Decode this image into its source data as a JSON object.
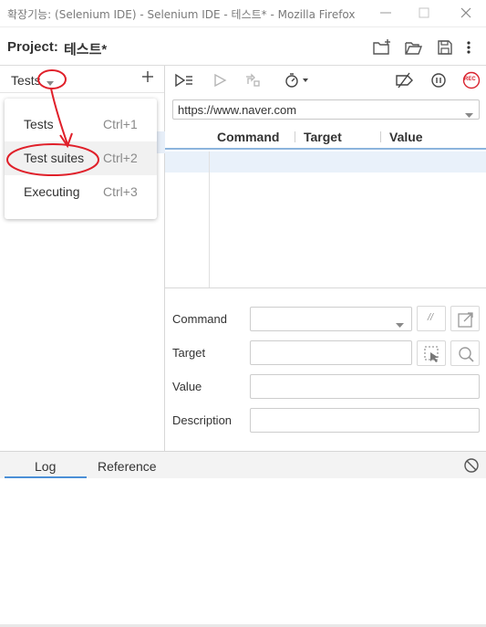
{
  "window": {
    "title": "확장기능: (Selenium IDE) - Selenium IDE - 테스트* - Mozilla Firefox"
  },
  "project": {
    "label": "Project:",
    "name": "테스트*"
  },
  "tests_panel": {
    "label": "Tests",
    "add_icon": "plus-icon",
    "menu": [
      {
        "label": "Tests",
        "shortcut": "Ctrl+1",
        "highlighted": false
      },
      {
        "label": "Test suites",
        "shortcut": "Ctrl+2",
        "highlighted": true
      },
      {
        "label": "Executing",
        "shortcut": "Ctrl+3",
        "highlighted": false
      }
    ]
  },
  "url_bar": {
    "value": "https://www.naver.com"
  },
  "table": {
    "columns": [
      "Command",
      "Target",
      "Value"
    ]
  },
  "form": {
    "command_label": "Command",
    "target_label": "Target",
    "value_label": "Value",
    "description_label": "Description",
    "comment_toggle": "//"
  },
  "bottom_tabs": {
    "log": "Log",
    "reference": "Reference"
  },
  "record_badge": "REC",
  "colors": {
    "accent_blue": "#4b8fd6",
    "record_red": "#d9232e",
    "annotation_red": "#e0202a",
    "row_highlight": "#e9f1fa"
  }
}
